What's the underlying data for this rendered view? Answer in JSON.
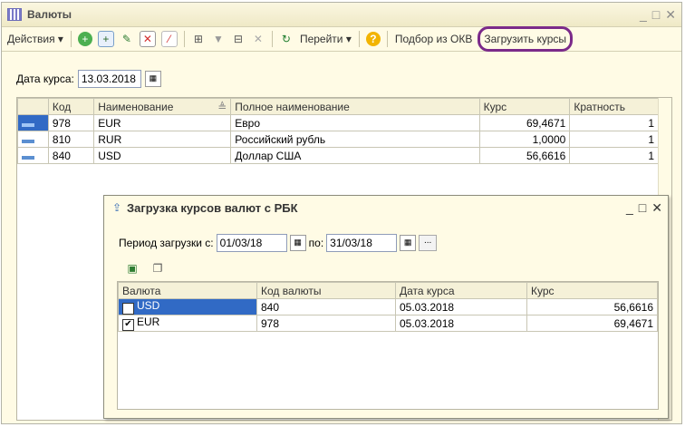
{
  "window": {
    "title": "Валюты"
  },
  "toolbar": {
    "actions_label": "Действия",
    "goto_label": "Перейти",
    "okv_label": "Подбор из ОКВ",
    "load_rates_label": "Загрузить курсы"
  },
  "rate_date": {
    "label": "Дата курса:",
    "value": "13.03.2018"
  },
  "currencies": {
    "columns": [
      "Код",
      "Наименование",
      "Полное наименование",
      "Курс",
      "Кратность"
    ],
    "rows": [
      {
        "code": "978",
        "name": "EUR",
        "full_name": "Евро",
        "rate": "69,4671",
        "multiplicity": "1"
      },
      {
        "code": "810",
        "name": "RUR",
        "full_name": "Российский рубль",
        "rate": "1,0000",
        "multiplicity": "1"
      },
      {
        "code": "840",
        "name": "USD",
        "full_name": "Доллар США",
        "rate": "56,6616",
        "multiplicity": "1"
      }
    ]
  },
  "dialog": {
    "title": "Загрузка курсов валют с РБК",
    "period_label": "Период загрузки с:",
    "date_from": "01/03/18",
    "to_label": "по:",
    "date_to": "31/03/18",
    "dots_label": "...",
    "columns": [
      "Валюта",
      "Код валюты",
      "Дата курса",
      "Курс"
    ],
    "rows": [
      {
        "currency": "USD",
        "code": "840",
        "date": "05.03.2018",
        "rate": "56,6616"
      },
      {
        "currency": "EUR",
        "code": "978",
        "date": "05.03.2018",
        "rate": "69,4671"
      }
    ]
  },
  "colors": {
    "selection": "#316ac5",
    "highlight_ring": "#7b2a8a",
    "window_bg": "#fffbe5"
  }
}
